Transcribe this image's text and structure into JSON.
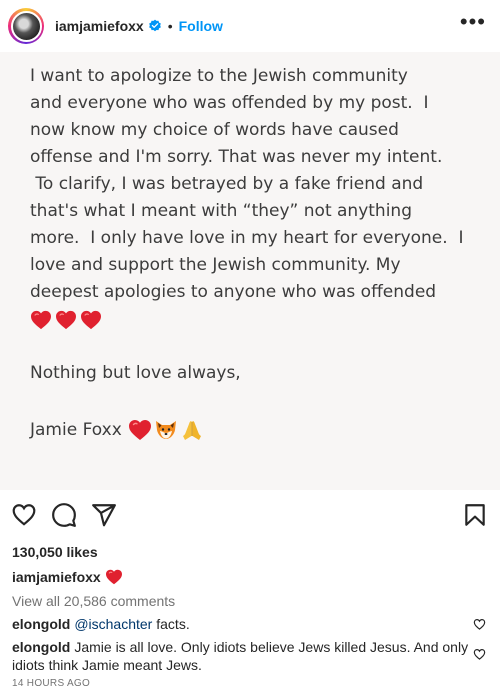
{
  "header": {
    "username": "iamjamiefoxx",
    "dot": "•",
    "follow_label": "Follow",
    "more_label": "•••"
  },
  "post": {
    "body": "I want to apologize to the Jewish community\nand everyone who was offended by my post.  I\nnow know my choice of words have caused\noffense and I'm sorry. That was never my intent.\n To clarify, I was betrayed by a fake friend and\nthat's what I meant with “they” not anything\nmore.  I only have love in my heart for everyone.  I\nlove and support the Jewish community. My\ndeepest apologies to anyone who was offended",
    "hearts_icon": "red-heart-icon",
    "closing": "Nothing but love always,",
    "signature": "Jamie Foxx",
    "signature_icons": [
      "red-heart-icon",
      "fox-icon",
      "folded-hands-icon"
    ]
  },
  "actions": {
    "icons": [
      "like-icon",
      "comment-icon",
      "share-icon",
      "save-icon"
    ]
  },
  "likes": "130,050 likes",
  "caption": {
    "username": "iamjamiefoxx",
    "icon": "red-heart-icon"
  },
  "view_comments": "View all 20,586 comments",
  "comments": [
    {
      "username": "elongold",
      "mention": "@ischachter",
      "text": " facts."
    },
    {
      "username": "elongold",
      "mention": "",
      "text": "Jamie is all love. Only idiots believe Jews killed Jesus. And only idiots think Jamie meant Jews."
    }
  ],
  "timestamp": "14 HOURS AGO",
  "colors": {
    "link_blue": "#0095f6",
    "heart_red": "#e0212f",
    "muted": "#737373"
  }
}
